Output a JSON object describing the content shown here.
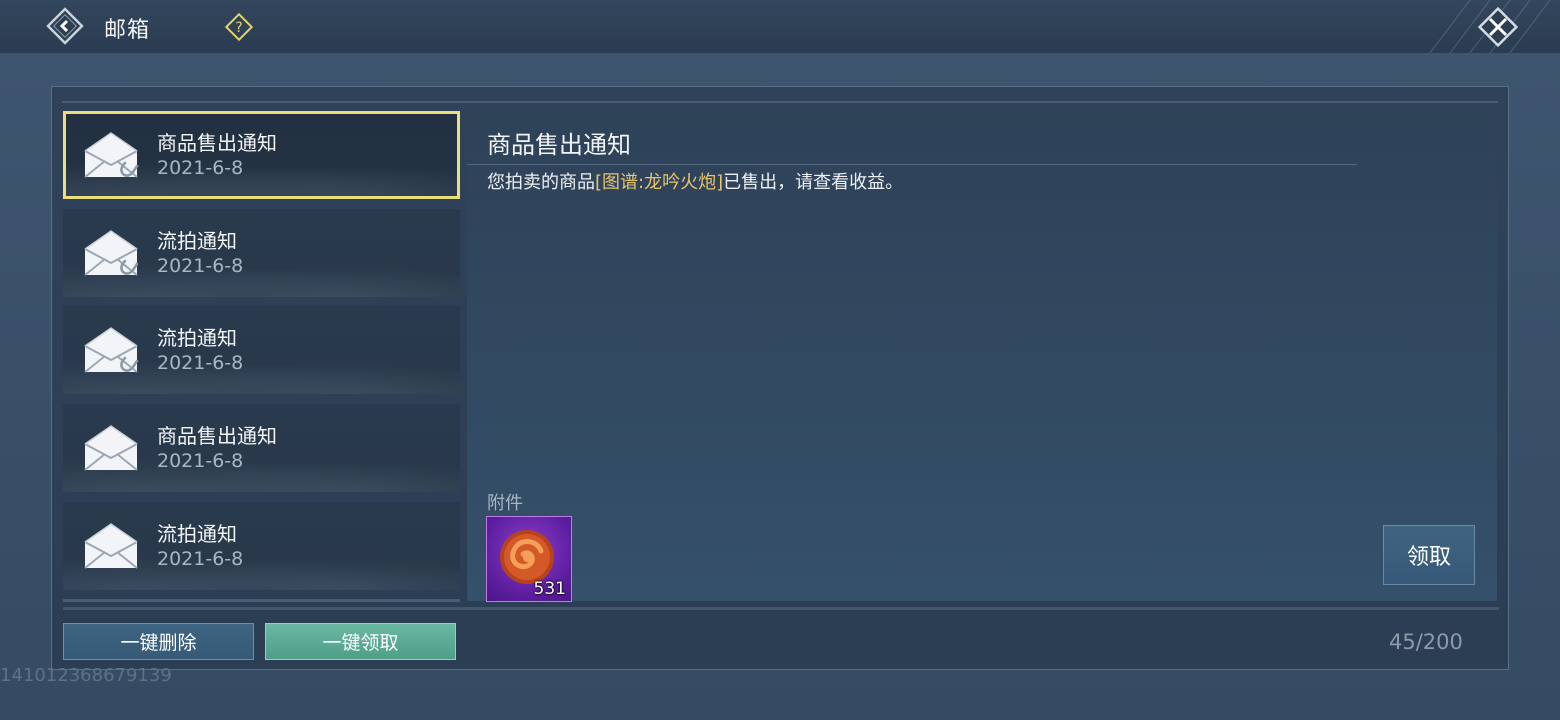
{
  "header": {
    "title": "邮箱",
    "back_icon": "back-arrow-icon",
    "help_icon": "help-icon",
    "close_icon": "close-icon"
  },
  "mail_list": [
    {
      "title": "商品售出通知",
      "date": "2021-6-8",
      "selected": true,
      "has_attachment": true
    },
    {
      "title": "流拍通知",
      "date": "2021-6-8",
      "selected": false,
      "has_attachment": true
    },
    {
      "title": "流拍通知",
      "date": "2021-6-8",
      "selected": false,
      "has_attachment": true
    },
    {
      "title": "商品售出通知",
      "date": "2021-6-8",
      "selected": false,
      "has_attachment": false
    },
    {
      "title": "流拍通知",
      "date": "2021-6-8",
      "selected": false,
      "has_attachment": false
    }
  ],
  "detail": {
    "title": "商品售出通知",
    "body_prefix": "您拍卖的商品",
    "body_item": "[图谱:龙吟火炮]",
    "body_suffix": "已售出，请查看收益。",
    "attachment_label": "附件",
    "attachment": {
      "icon": "currency-item-icon",
      "count": "531"
    },
    "claim_label": "领取"
  },
  "footer": {
    "delete_all_label": "一键删除",
    "claim_all_label": "一键领取",
    "mail_count": "45/200"
  },
  "user_id": "141012368679139",
  "colors": {
    "selected_border": "#e9df7d",
    "item_highlight": "#e8c46a",
    "claim_all_bg": "#5aab94",
    "rarity_purple": "#7a33c0"
  }
}
